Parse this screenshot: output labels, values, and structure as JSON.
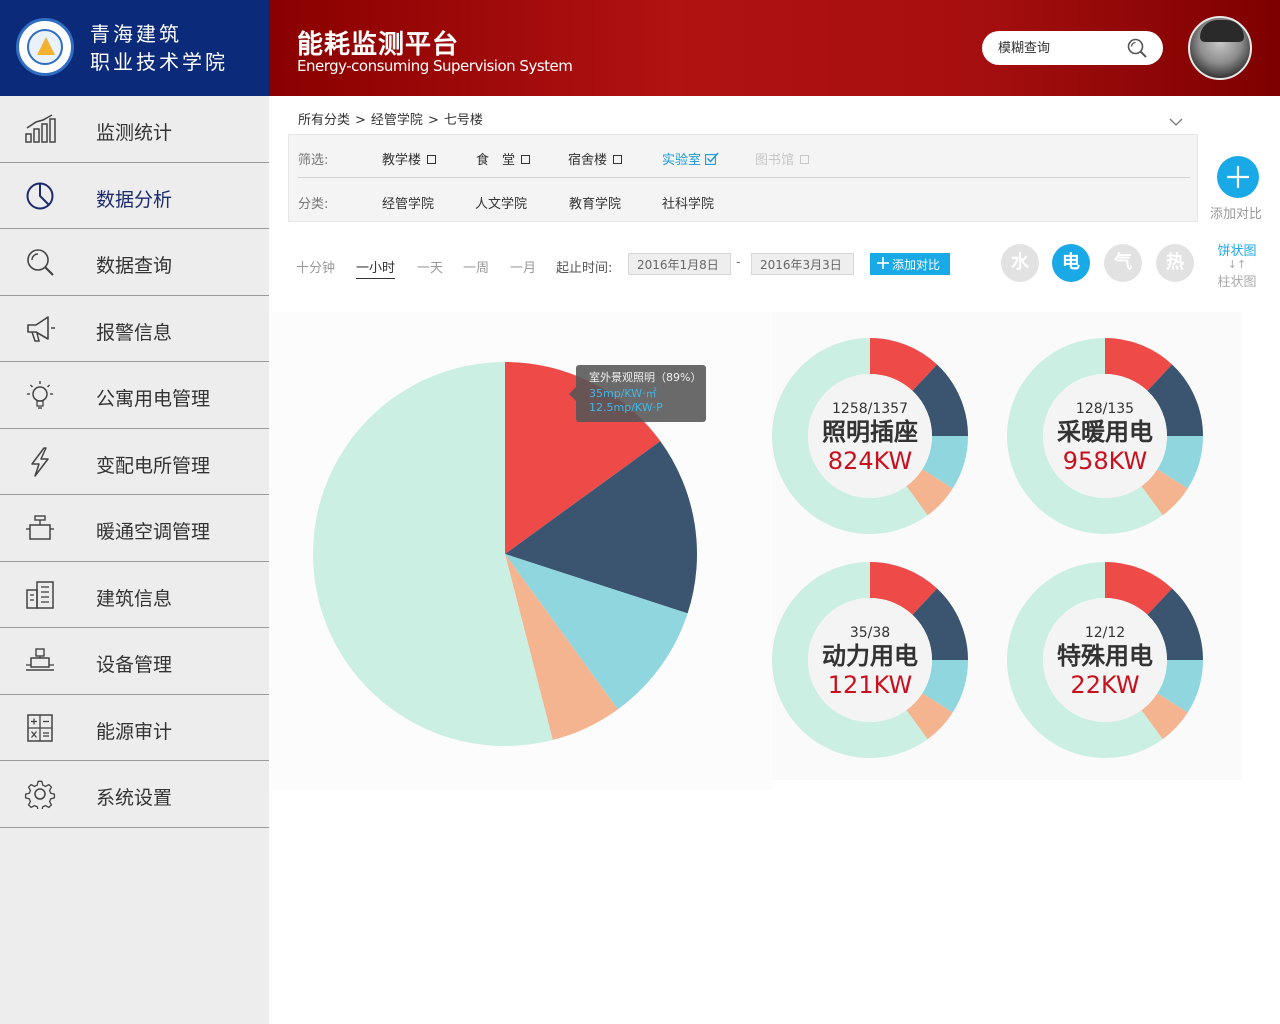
{
  "header": {
    "school_name_line1": "青海建筑",
    "school_name_line2": "职业技术学院",
    "app_title": "能耗监测平台",
    "app_subtitle": "Energy-consuming Supervision System",
    "search_placeholder": "模糊查询"
  },
  "sidebar": {
    "items": [
      {
        "label": "监测统计",
        "icon": "bar-chart-icon"
      },
      {
        "label": "数据分析",
        "icon": "pie-chart-icon",
        "active": true
      },
      {
        "label": "数据查询",
        "icon": "search-icon"
      },
      {
        "label": "报警信息",
        "icon": "megaphone-icon"
      },
      {
        "label": "公寓用电管理",
        "icon": "light-bulb-icon"
      },
      {
        "label": "变配电所管理",
        "icon": "lightning-icon"
      },
      {
        "label": "暖通空调管理",
        "icon": "hvac-icon"
      },
      {
        "label": "建筑信息",
        "icon": "building-icon"
      },
      {
        "label": "设备管理",
        "icon": "device-icon"
      },
      {
        "label": "能源审计",
        "icon": "calculator-icon"
      },
      {
        "label": "系统设置",
        "icon": "gear-icon"
      }
    ]
  },
  "breadcrumb": [
    "所有分类",
    "经管学院",
    "七号楼"
  ],
  "breadcrumb_sep": ">",
  "filter": {
    "label": "筛选:",
    "options": [
      {
        "label": "教学楼",
        "state": "unchecked"
      },
      {
        "label": "食　堂",
        "state": "unchecked"
      },
      {
        "label": "宿舍楼",
        "state": "unchecked"
      },
      {
        "label": "实验室",
        "state": "checked"
      },
      {
        "label": "图书馆",
        "state": "disabled"
      }
    ]
  },
  "category": {
    "label": "分类:",
    "options": [
      "经管学院",
      "人文学院",
      "教育学院",
      "社科学院"
    ]
  },
  "add_compare_round_label": "添加对比",
  "time_options": [
    {
      "label": "十分钟",
      "active": false
    },
    {
      "label": "一小时",
      "active": true
    },
    {
      "label": "一天",
      "active": false
    },
    {
      "label": "一周",
      "active": false
    },
    {
      "label": "一月",
      "active": false
    }
  ],
  "date_range": {
    "label": "起止时间:",
    "start": "2016年1月8日",
    "separator": "-",
    "end": "2016年3月3日"
  },
  "add_compare_button": "添加对比",
  "energy_types": [
    {
      "label": "水",
      "active": false
    },
    {
      "label": "电",
      "active": true
    },
    {
      "label": "气",
      "active": false
    },
    {
      "label": "热",
      "active": false
    }
  ],
  "chart_toggle": {
    "primary": "饼状图",
    "swap": "↓↑",
    "secondary": "柱状图"
  },
  "colors": {
    "red": "#ee4a48",
    "navy": "#3b5570",
    "cyan": "#8fd6de",
    "orange": "#f4b490",
    "mint": "#ccefe3",
    "accent": "#19a9e6",
    "value_red": "#c8111e"
  },
  "tooltip": {
    "title": "室外景观照明（89%）",
    "line1": "35mp/KW·㎡",
    "line2": "12.5mp/KW·P"
  },
  "chart_data": [
    {
      "type": "pie",
      "categories": [
        "red",
        "navy",
        "cyan",
        "orange",
        "mint"
      ],
      "values": [
        15,
        15,
        10,
        6,
        54
      ]
    },
    {
      "type": "pie",
      "ratio": "1258/1357",
      "title": "照明插座",
      "value": "824KW",
      "categories": [
        "red",
        "navy",
        "cyan",
        "orange",
        "mint"
      ],
      "values": [
        12,
        13,
        9,
        6,
        60
      ]
    },
    {
      "type": "pie",
      "ratio": "128/135",
      "title": "采暖用电",
      "value": "958KW",
      "categories": [
        "red",
        "navy",
        "cyan",
        "orange",
        "mint"
      ],
      "values": [
        12,
        13,
        9,
        6,
        60
      ]
    },
    {
      "type": "pie",
      "ratio": "35/38",
      "title": "动力用电",
      "value": "121KW",
      "categories": [
        "red",
        "navy",
        "cyan",
        "orange",
        "mint"
      ],
      "values": [
        12,
        13,
        9,
        6,
        60
      ]
    },
    {
      "type": "pie",
      "ratio": "12/12",
      "title": "特殊用电",
      "value": "22KW",
      "categories": [
        "red",
        "navy",
        "cyan",
        "orange",
        "mint"
      ],
      "values": [
        12,
        13,
        9,
        6,
        60
      ]
    }
  ]
}
